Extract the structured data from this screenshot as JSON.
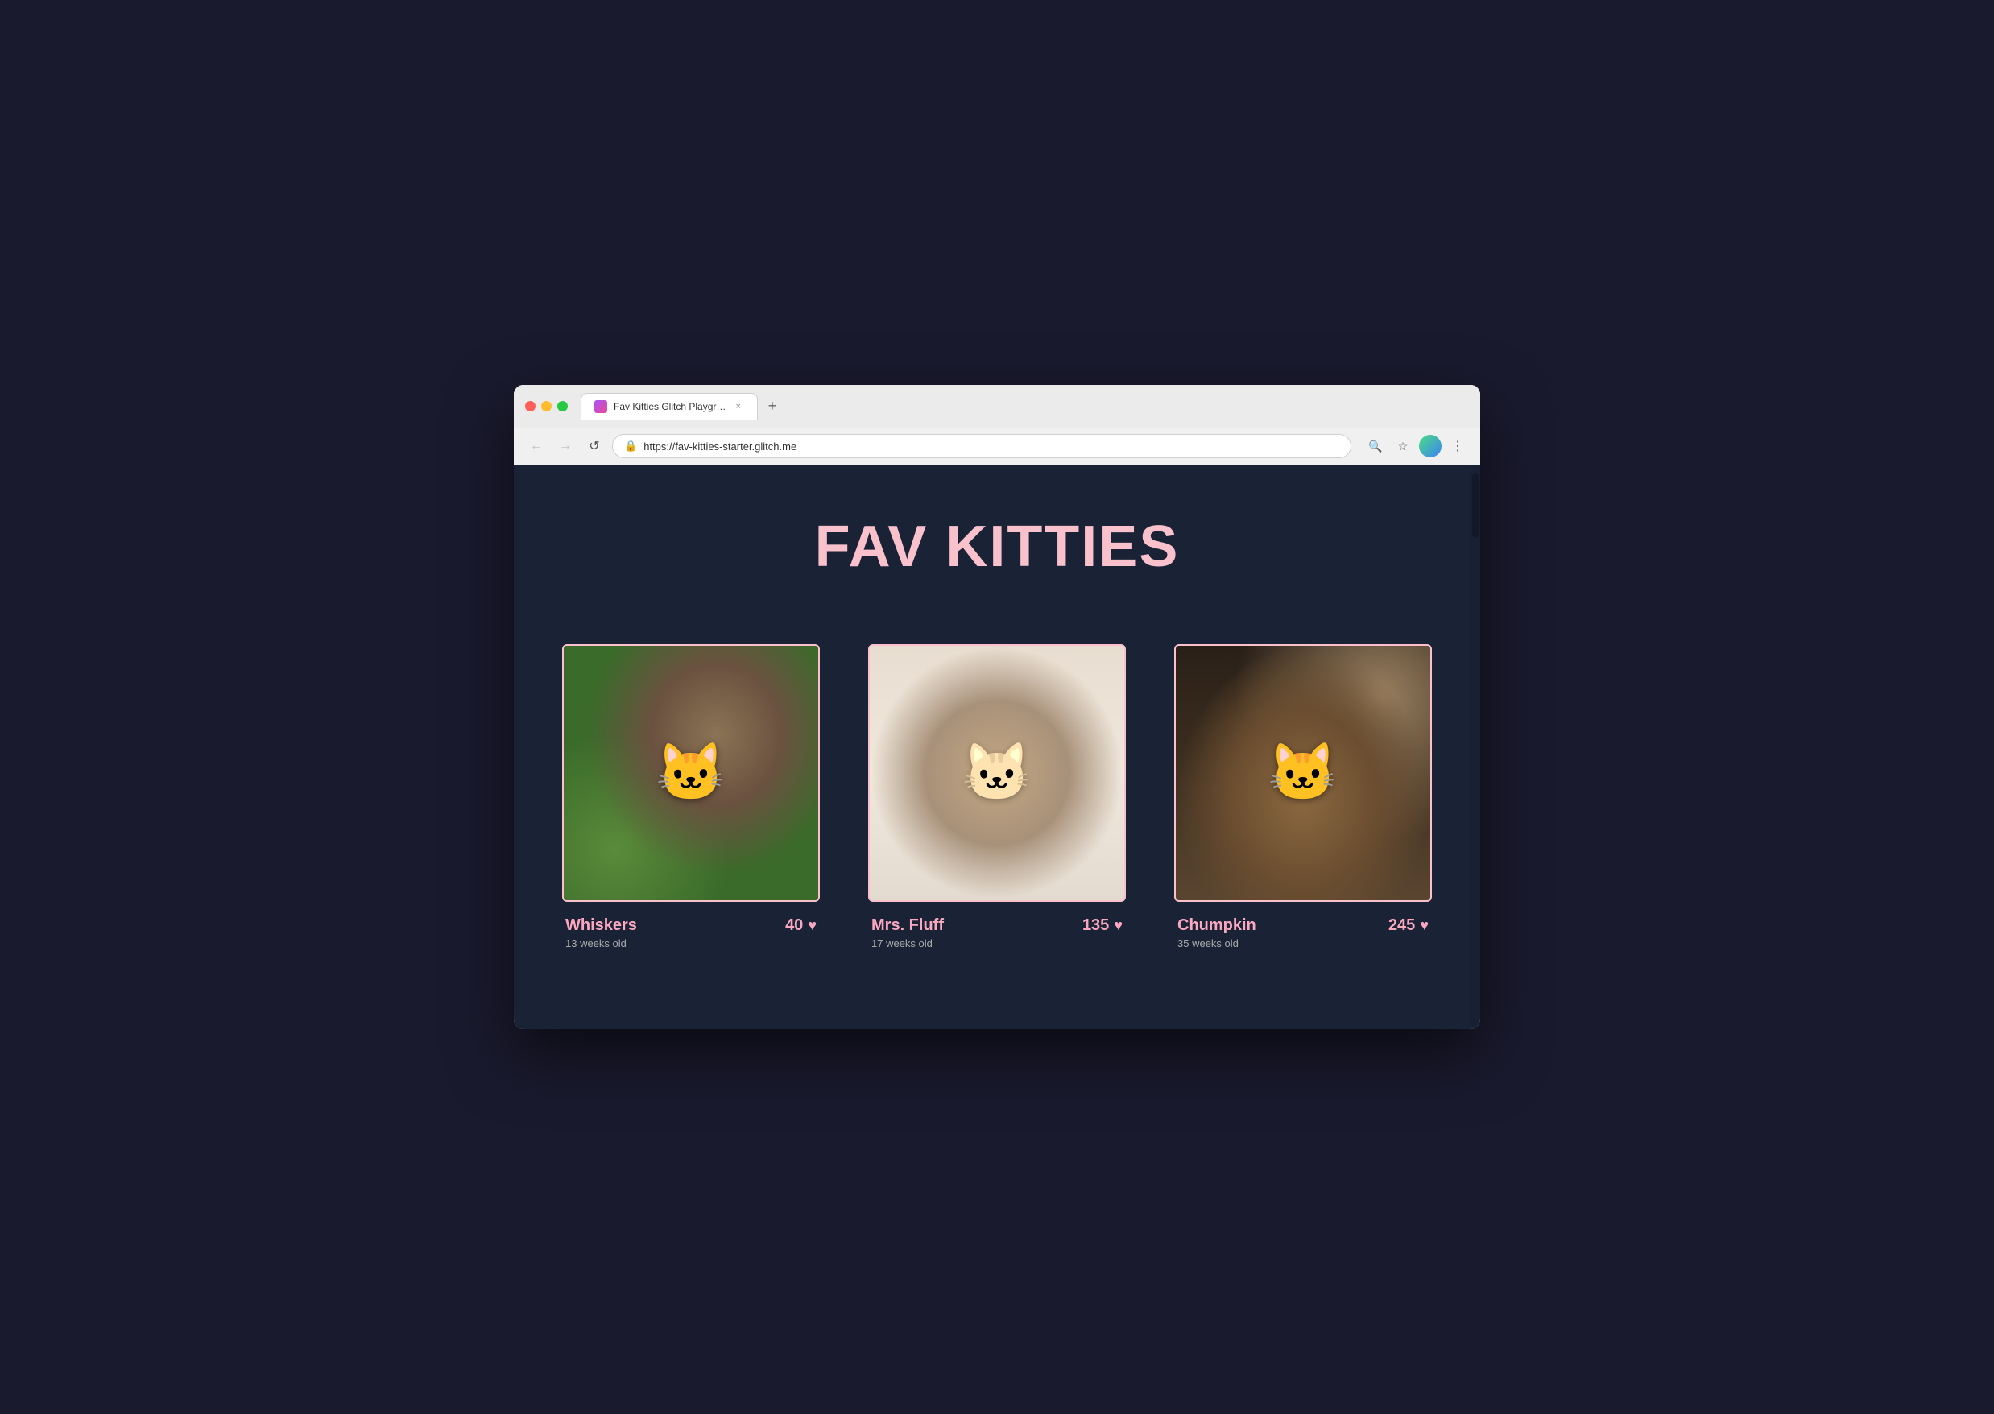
{
  "browser": {
    "tab": {
      "title": "Fav Kitties Glitch Playground",
      "close_label": "×",
      "new_tab_label": "+"
    },
    "addressbar": {
      "url": "https://fav-kitties-starter.glitch.me",
      "back_label": "←",
      "forward_label": "→",
      "refresh_label": "↺"
    },
    "toolbar": {
      "search_label": "🔍",
      "star_label": "☆",
      "menu_label": "⋮"
    }
  },
  "site": {
    "title": "FAV KITTIES",
    "cats": [
      {
        "id": 1,
        "name": "Whiskers",
        "age": "13 weeks old",
        "votes": "40",
        "image_style": "cat-img-1"
      },
      {
        "id": 2,
        "name": "Mrs. Fluff",
        "age": "17 weeks old",
        "votes": "135",
        "image_style": "cat-img-2"
      },
      {
        "id": 3,
        "name": "Chumpkin",
        "age": "35 weeks old",
        "votes": "245",
        "image_style": "cat-img-3"
      }
    ]
  }
}
